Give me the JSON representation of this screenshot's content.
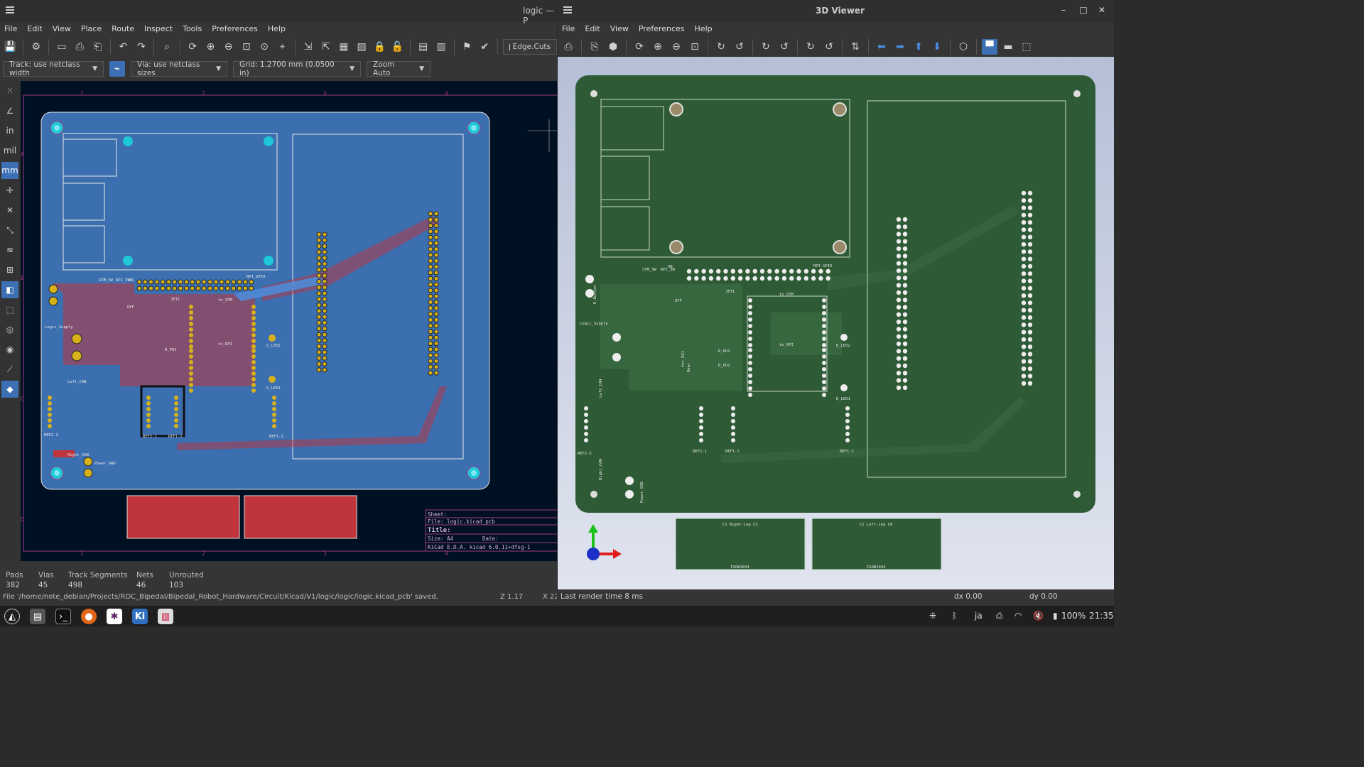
{
  "pcb": {
    "title": "logic — P",
    "menu": [
      "File",
      "Edit",
      "View",
      "Place",
      "Route",
      "Inspect",
      "Tools",
      "Preferences",
      "Help"
    ],
    "layer_selector": "Edge.Cuts",
    "track_width": "Track: use netclass width",
    "via_size": "Via: use netclass sizes",
    "grid": "Grid: 1.2700 mm (0.0500 in)",
    "zoom": "Zoom Auto",
    "left_tools": [
      "in",
      "mil",
      "mm"
    ],
    "ruler_top": [
      "1",
      "2",
      "3",
      "4"
    ],
    "ruler_left": [
      "A",
      "B",
      "C",
      "D"
    ],
    "labels": {
      "stm_sw": "STM_SW",
      "rpi_sw": "RPI_SW",
      "rpi_gpio": "RPI_GPIO",
      "to_stm": "to_STM",
      "to_rpi": "to_RPI",
      "jet1": "JET1",
      "logic_supply": "Logic_Supply",
      "r_pu1": "R_PU1",
      "d_led1": "D_LED1",
      "d_led2": "D_LED2",
      "left_can": "Left_CAN",
      "right_can": "Right_CAN",
      "ref2_2": "REF2-2",
      "ref2_1": "REF2-1",
      "ref1_2": "REF1-2",
      "ref1_1": "REF1-1",
      "power_gnd": "Power_GND",
      "on": "ON",
      "off": "OFF"
    },
    "title_block": {
      "sheet": "Sheet:",
      "file": "File: logic.kicad_pcb",
      "title": "Title:",
      "size": "Size: A4",
      "date": "Date:",
      "kicad": "KiCad E.D.A.  kicad 6.0.11+dfsg-1"
    },
    "stats": {
      "pads_label": "Pads",
      "pads": "382",
      "vias_label": "Vias",
      "vias": "45",
      "tracks_label": "Track Segments",
      "tracks": "498",
      "nets_label": "Nets",
      "nets": "46",
      "unrouted_label": "Unrouted",
      "unrouted": "103"
    },
    "message": "File '/home/note_debian/Projects/RDC_Bipedal/Bipedal_Robot_Hardware/Circuit/Kicad/V1/logic/logic/logic.kicad_pcb' saved.",
    "zoom_readout": "Z 1.17",
    "x_readout": "X 22"
  },
  "viewer3d": {
    "title": "3D Viewer",
    "menu": [
      "File",
      "Edit",
      "View",
      "Preferences",
      "Help"
    ],
    "labels": {
      "stm_sw": "STM_SW",
      "rpi_sw": "RPI_SW",
      "rpi_gpio": "RPI_GPIO",
      "to_stm": "to_STM",
      "to_rpi": "to_RPI",
      "jet1": "JET1",
      "logic_supply": "Logic_Supply",
      "e_button": "E-Button",
      "r_pu1": "R_PU1",
      "r_pu2": "R_PU2",
      "d_led1": "D_LED1",
      "d_led2": "D_LED2",
      "left_can": "Left_CAN",
      "right_can": "Right_CAN",
      "ref2_2": "REF2-2",
      "ref2_1": "REF2-1",
      "ref1_2": "REF1-2",
      "ref1_1": "REF1-1",
      "power_gnd": "Power_GND",
      "for_rs": "for_RS1",
      "rear": "Rear",
      "on": "ON",
      "off": "OFF",
      "right_leg": "C1 Right-Leg C5",
      "left_leg": "C1 Left-Leg C6",
      "isow": "ISOW1044"
    },
    "status": "Last render time 8 ms",
    "dx": "dx 0.00",
    "dy": "dy 0.00"
  },
  "taskbar": {
    "lang": "ja",
    "battery": "100%",
    "time": "21:35"
  },
  "colors": {
    "board_blue": "#3b6fb0",
    "copper_red": "#c0343c",
    "pad_yellow": "#d6b11a",
    "pcb_green": "#2e5a36",
    "accent": "#3d6fb4"
  }
}
